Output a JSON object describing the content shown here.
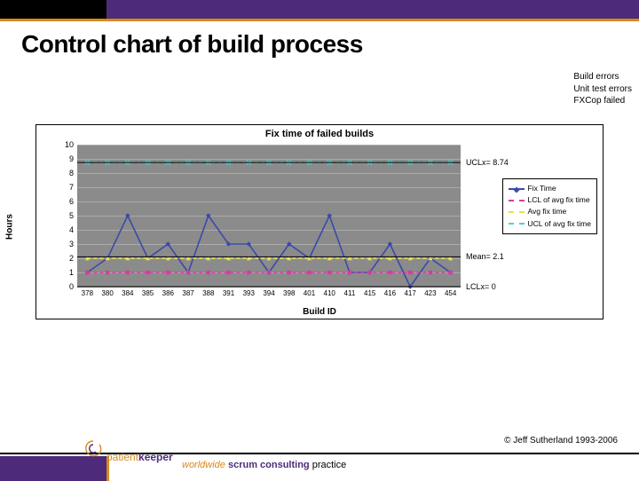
{
  "title": "Control chart of build process",
  "notes": [
    "Build errors",
    "Unit test errors",
    "FXCop failed"
  ],
  "chart_data": {
    "type": "line",
    "title": "Fix time of failed builds",
    "xlabel": "Build ID",
    "ylabel": "Hours",
    "ylim": [
      0,
      10
    ],
    "yticks": [
      0,
      1,
      2,
      3,
      4,
      5,
      6,
      7,
      8,
      9,
      10
    ],
    "categories": [
      "378",
      "380",
      "384",
      "385",
      "386",
      "387",
      "388",
      "391",
      "393",
      "394",
      "398",
      "401",
      "410",
      "411",
      "415",
      "416",
      "417",
      "423",
      "454"
    ],
    "series": [
      {
        "name": "Fix Time",
        "color": "#3b4aa8",
        "values": [
          1,
          2,
          5,
          2,
          3,
          1,
          5,
          3,
          3,
          1,
          3,
          2,
          5,
          1,
          1,
          3,
          0,
          2,
          1
        ]
      },
      {
        "name": "LCL of avg fix time",
        "color": "#d63ca0",
        "dashed": true,
        "values": [
          1,
          1,
          1,
          1,
          1,
          1,
          1,
          1,
          1,
          1,
          1,
          1,
          1,
          1,
          1,
          1,
          1,
          1,
          1
        ],
        "marker": "square"
      },
      {
        "name": "Avg fix time",
        "color": "#e9e24a",
        "dashed": true,
        "values": [
          2,
          2,
          2,
          2,
          2,
          2,
          2,
          2,
          2,
          2,
          2,
          2,
          2,
          2,
          2,
          2,
          2,
          2,
          2
        ],
        "marker": "triangle"
      },
      {
        "name": "UCL of avg fix time",
        "color": "#4fd1d1",
        "dashed": true,
        "values": [
          8.74,
          8.74,
          8.74,
          8.74,
          8.74,
          8.74,
          8.74,
          8.74,
          8.74,
          8.74,
          8.74,
          8.74,
          8.74,
          8.74,
          8.74,
          8.74,
          8.74,
          8.74,
          8.74
        ],
        "marker": "x"
      }
    ],
    "ref_lines": [
      {
        "label": "UCLx= 8.74",
        "value": 8.74
      },
      {
        "label": "Mean= 2.1",
        "value": 2.1
      },
      {
        "label": "LCLx= 0",
        "value": 0
      }
    ],
    "legend": [
      "Fix Time",
      "LCL of avg fix time",
      "Avg fix time",
      "UCL of avg fix time"
    ]
  },
  "logo": {
    "brand1": "patient",
    "brand2": "keeper"
  },
  "tagline": {
    "t1": "worldwide ",
    "t2": "scrum consulting ",
    "t3": "practice"
  },
  "copyright": "© Jeff Sutherland 1993-2006"
}
